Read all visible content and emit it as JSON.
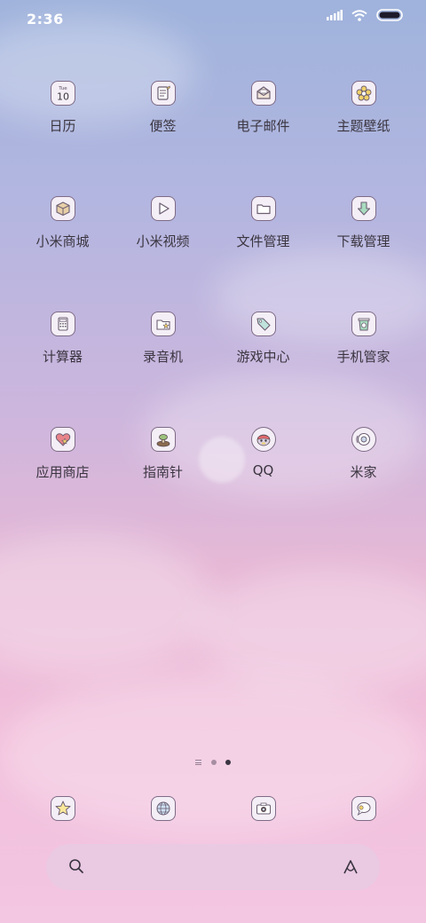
{
  "status": {
    "time": "2:36"
  },
  "apps": [
    {
      "label": "日历",
      "icon": "calendar-icon",
      "day": "Tue",
      "date": "10"
    },
    {
      "label": "便签",
      "icon": "notes-icon"
    },
    {
      "label": "电子邮件",
      "icon": "email-icon"
    },
    {
      "label": "主题壁纸",
      "icon": "theme-flower-icon"
    },
    {
      "label": "小米商城",
      "icon": "store-box-icon"
    },
    {
      "label": "小米视频",
      "icon": "video-play-icon"
    },
    {
      "label": "文件管理",
      "icon": "folder-icon"
    },
    {
      "label": "下载管理",
      "icon": "download-arrow-icon"
    },
    {
      "label": "计算器",
      "icon": "calculator-icon"
    },
    {
      "label": "录音机",
      "icon": "recorder-icon"
    },
    {
      "label": "游戏中心",
      "icon": "tag-icon"
    },
    {
      "label": "手机管家",
      "icon": "security-bin-icon"
    },
    {
      "label": "应用商店",
      "icon": "app-store-heart-icon"
    },
    {
      "label": "指南针",
      "icon": "compass-mushroom-icon"
    },
    {
      "label": "QQ",
      "icon": "qq-penguin-icon"
    },
    {
      "label": "米家",
      "icon": "mijia-icon"
    }
  ],
  "page_indicator": {
    "pages": 2,
    "current": 2
  },
  "dock": [
    {
      "icon": "star-icon"
    },
    {
      "icon": "browser-globe-icon"
    },
    {
      "icon": "camera-icon"
    },
    {
      "icon": "messages-bubble-icon"
    }
  ],
  "search": {
    "icon": "search-icon",
    "assistant_icon": "assistant-icon"
  }
}
